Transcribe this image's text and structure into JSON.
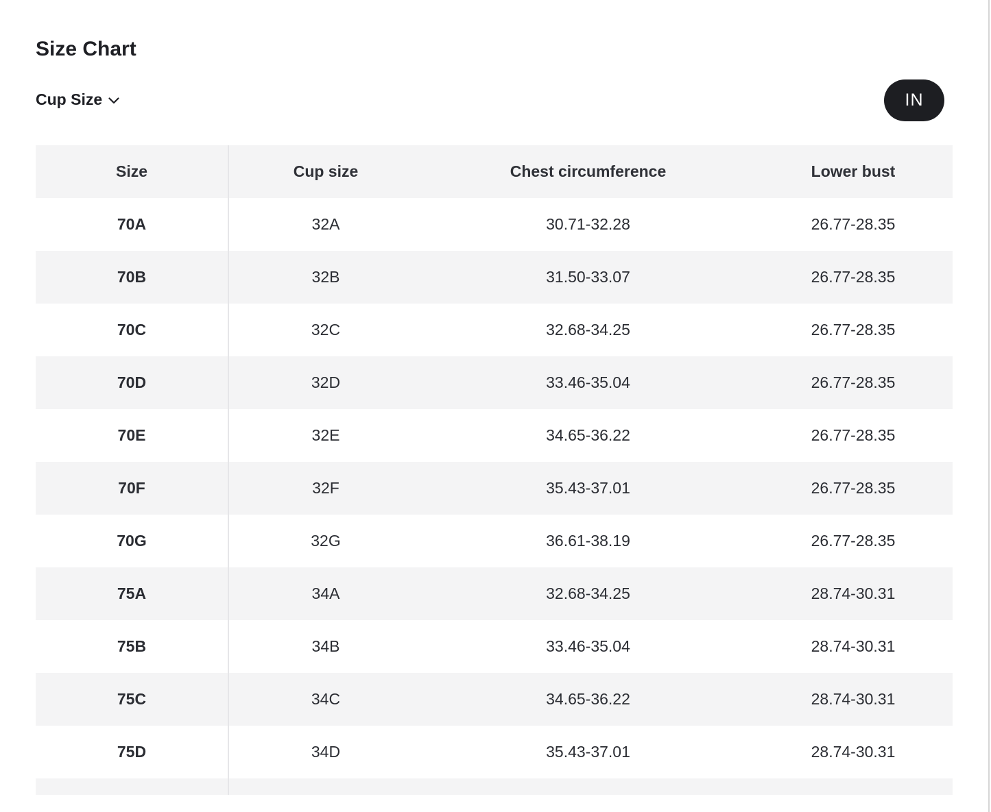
{
  "title": "Size Chart",
  "cup_toggle_label": "Cup Size",
  "unit_button": "IN",
  "table": {
    "headers": [
      "Size",
      "Cup size",
      "Chest circumference",
      "Lower bust"
    ],
    "rows": [
      [
        "70A",
        "32A",
        "30.71-32.28",
        "26.77-28.35"
      ],
      [
        "70B",
        "32B",
        "31.50-33.07",
        "26.77-28.35"
      ],
      [
        "70C",
        "32C",
        "32.68-34.25",
        "26.77-28.35"
      ],
      [
        "70D",
        "32D",
        "33.46-35.04",
        "26.77-28.35"
      ],
      [
        "70E",
        "32E",
        "34.65-36.22",
        "26.77-28.35"
      ],
      [
        "70F",
        "32F",
        "35.43-37.01",
        "26.77-28.35"
      ],
      [
        "70G",
        "32G",
        "36.61-38.19",
        "26.77-28.35"
      ],
      [
        "75A",
        "34A",
        "32.68-34.25",
        "28.74-30.31"
      ],
      [
        "75B",
        "34B",
        "33.46-35.04",
        "28.74-30.31"
      ],
      [
        "75C",
        "34C",
        "34.65-36.22",
        "28.74-30.31"
      ],
      [
        "75D",
        "34D",
        "35.43-37.01",
        "28.74-30.31"
      ],
      [
        "",
        "",
        "",
        ""
      ]
    ]
  },
  "icons": {
    "dropdown": "chevron-down-icon"
  },
  "colors": {
    "unit_button_bg": "#1d1e22",
    "stripe_bg": "#f4f4f5",
    "text": "#2b2d33"
  }
}
